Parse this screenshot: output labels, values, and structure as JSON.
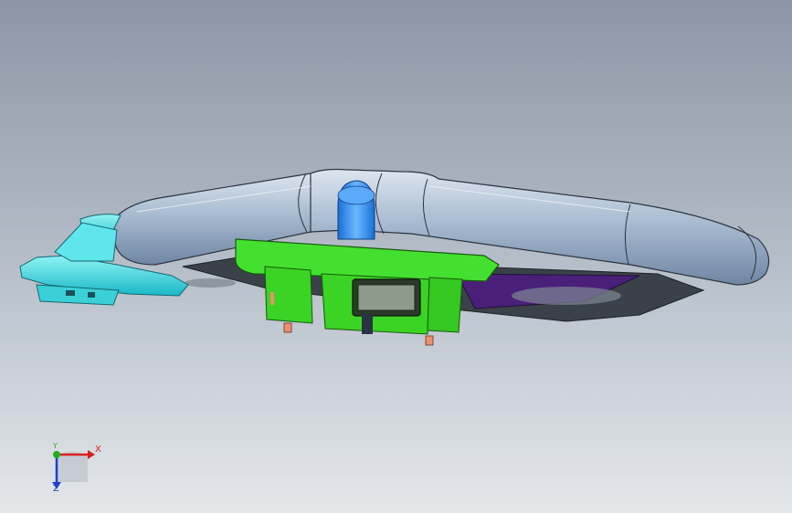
{
  "viewport": {
    "background_top": "#8c97a6",
    "background_bottom": "#e4e7ea"
  },
  "model": {
    "frame_color": "#b8c8dc",
    "base_color": "#3a4148",
    "base_panel_color": "#4a1f7a",
    "tube_color": "#2f8cf0",
    "board_color": "#33dd22",
    "bracket_color": "#22d6d6",
    "pin_color": "#e89070"
  },
  "triad": {
    "x_label": "X",
    "y_label": "Y",
    "z_label": "Z",
    "x_color": "#d81e1e",
    "y_color": "#1fae1f",
    "z_color": "#1f3fd0"
  }
}
